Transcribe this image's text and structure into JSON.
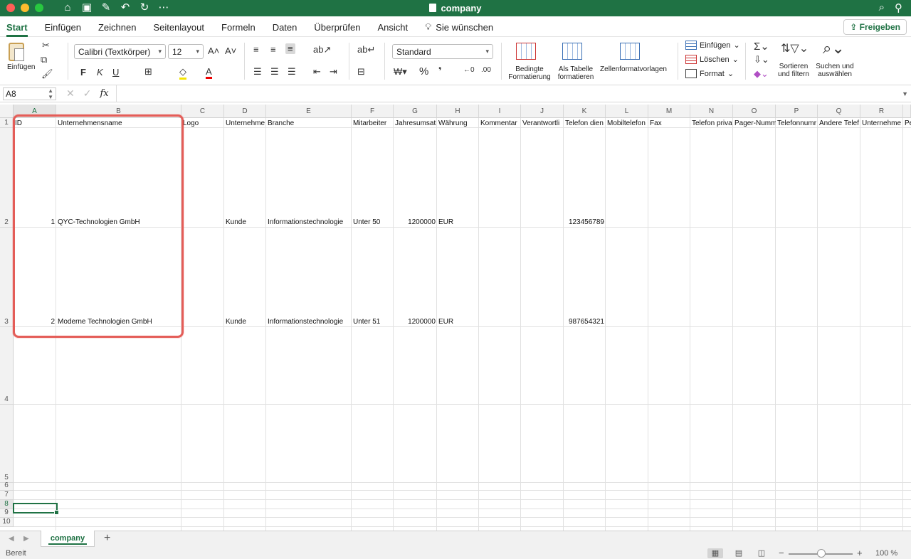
{
  "window": {
    "title": "company"
  },
  "tabs": [
    "Start",
    "Einfügen",
    "Zeichnen",
    "Seitenlayout",
    "Formeln",
    "Daten",
    "Überprüfen",
    "Ansicht"
  ],
  "tell_me": "Sie wünschen",
  "share_label": "Freigeben",
  "ribbon": {
    "paste_label": "Einfügen",
    "font_name": "Calibri (Textkörper)",
    "font_size": "12",
    "bold": "F",
    "italic": "K",
    "underline": "U",
    "number_format": "Standard",
    "percent": "%",
    "thousands": "❜",
    "cond_format": [
      "Bedingte",
      "Formatierung"
    ],
    "as_table": [
      "Als Tabelle",
      "formatieren"
    ],
    "cell_styles": "Zellenformatvorlagen",
    "insert": "Einfügen",
    "delete": "Löschen",
    "format": "Format",
    "sort_filter": [
      "Sortieren",
      "und filtern"
    ],
    "find_select": [
      "Suchen und",
      "auswählen"
    ],
    "accent_color": "#1f7244"
  },
  "formula_bar": {
    "name_box": "A8",
    "fx": "fx",
    "value": ""
  },
  "columns": [
    "A",
    "B",
    "C",
    "D",
    "E",
    "F",
    "G",
    "H",
    "I",
    "J",
    "K",
    "L",
    "M",
    "N",
    "O",
    "P",
    "Q",
    "R"
  ],
  "rows": [
    "1",
    "2",
    "3",
    "4",
    "5",
    "6",
    "7",
    "8",
    "9",
    "10"
  ],
  "headers": [
    "ID",
    "Unternehmensname",
    "Logo",
    "Unternehme",
    "Branche",
    "Mitarbeiter",
    "Jahresumsat",
    "Währung",
    "Kommentar",
    "Verantwortli",
    "Telefon dien",
    "Mobiltelefon",
    "Fax",
    "Telefon priva",
    "Pager-Numm",
    "Telefonnumr",
    "Andere Telef",
    "Unternehme",
    "Pe"
  ],
  "data_rows": [
    {
      "id": "1",
      "name": "QYC-Technologien GmbH",
      "type": "Kunde",
      "branche": "Informationstechnologie",
      "mitarbeiter": "Unter 50",
      "umsatz": "1200000",
      "waehrung": "EUR",
      "telefon": "123456789"
    },
    {
      "id": "2",
      "name": "Moderne Technologien GmbH",
      "type": "Kunde",
      "branche": "Informationstechnologie",
      "mitarbeiter": "Unter 51",
      "umsatz": "1200000",
      "waehrung": "EUR",
      "telefon": "987654321"
    }
  ],
  "sheet_tab": "company",
  "status": {
    "text": "Bereit",
    "zoom": "100 %"
  }
}
